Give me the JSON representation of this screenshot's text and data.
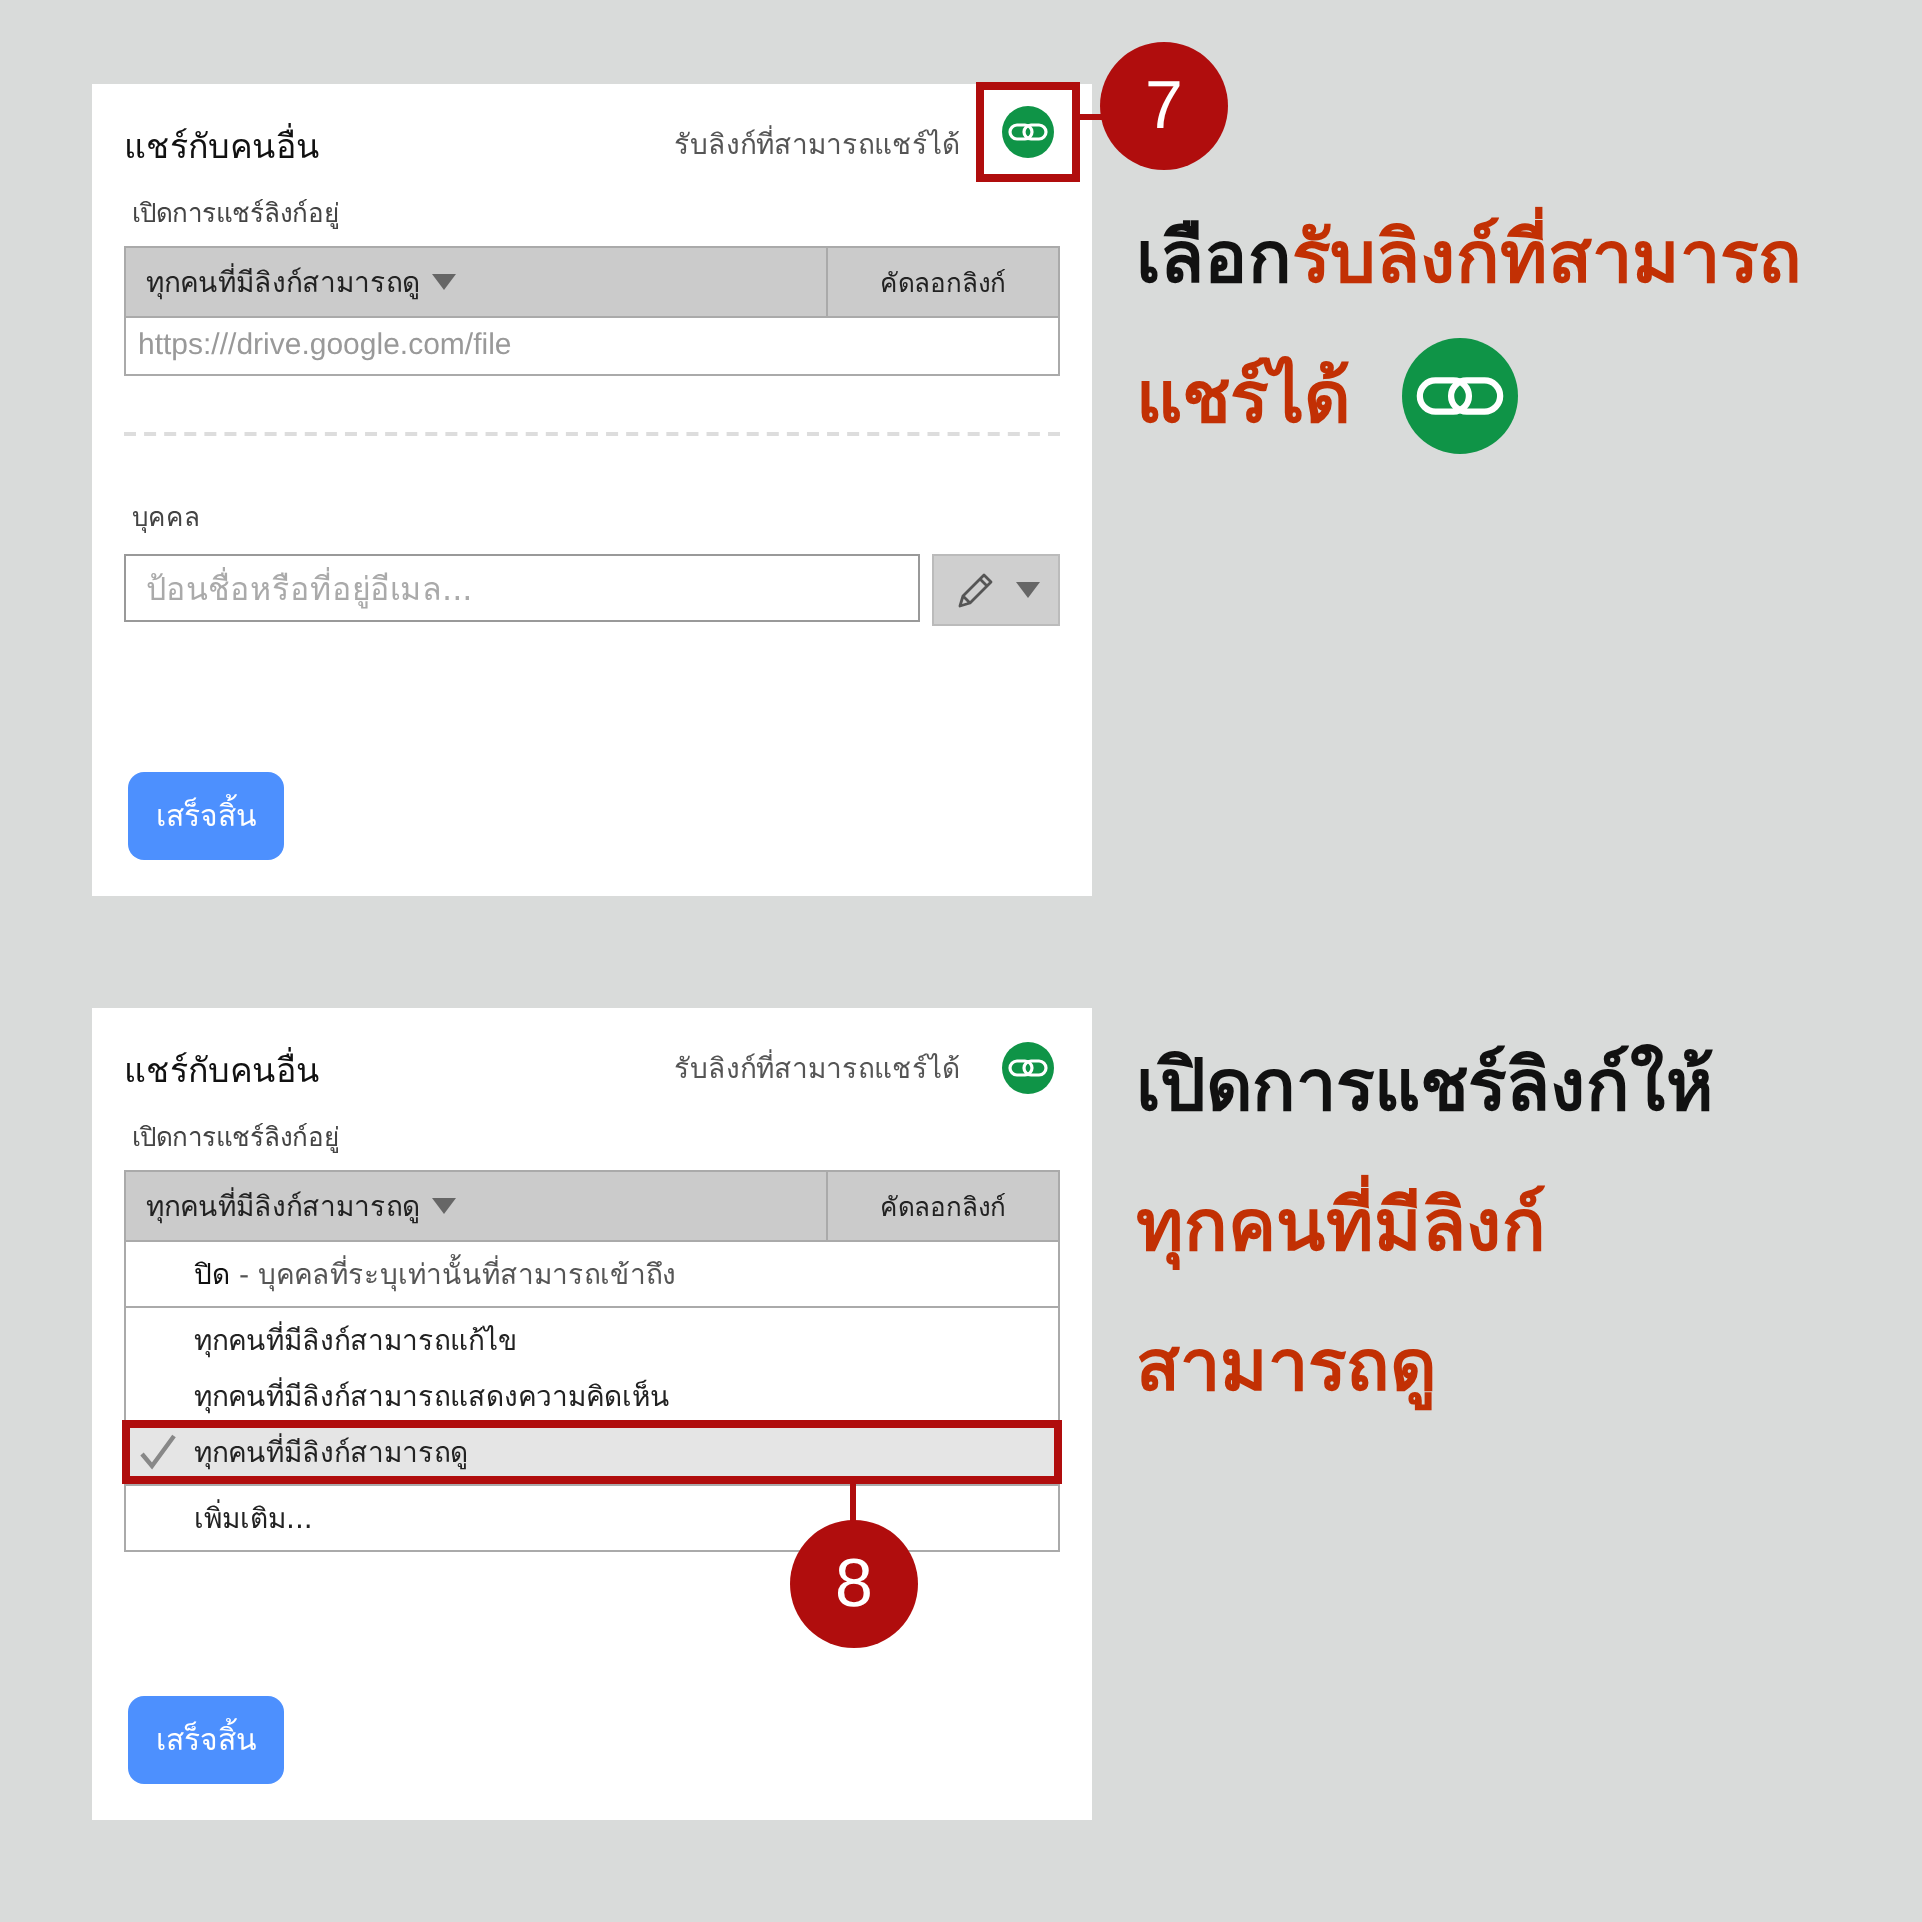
{
  "steps": [
    {
      "number": "7",
      "caption": [
        [
          {
            "text": "เลือก",
            "emphasis": false
          },
          {
            "text": "รับลิงก์ที่สามารถ",
            "emphasis": true
          }
        ],
        [
          {
            "text": "แชร์ได้",
            "emphasis": true
          }
        ]
      ],
      "caption_icon": true,
      "dialog": {
        "title": "แชร์กับคนอื่น",
        "link_label": "รับลิงก์ที่สามารถแชร์ได้",
        "link_icon_highlighted": true,
        "section_label": "เปิดการแชร์ลิงก์อยู่",
        "access": "ทุกคนที่มีลิงก์สามารถดู",
        "copy_link": "คัดลอกลิงก์",
        "url": "https:///drive.google.com/file",
        "people_label": "บุคคล",
        "people_placeholder": "ป้อนชื่อหรือที่อยู่อีเมล...",
        "done": "เสร็จสิ้น"
      }
    },
    {
      "number": "8",
      "caption": [
        [
          {
            "text": "เปิดการแชร์ลิงก์ให้",
            "emphasis": false
          }
        ],
        [
          {
            "text": "ทุกคนที่มีลิงก์",
            "emphasis": true
          }
        ],
        [
          {
            "text": "สามารถดู",
            "emphasis": true
          }
        ]
      ],
      "caption_icon": false,
      "dialog": {
        "title": "แชร์กับคนอื่น",
        "link_label": "รับลิงก์ที่สามารถแชร์ได้",
        "link_icon_highlighted": false,
        "section_label": "เปิดการแชร์ลิงก์อยู่",
        "access": "ทุกคนที่มีลิงก์สามารถดู",
        "copy_link": "คัดลอกลิงก์",
        "menu": [
          [
            {
              "label": "**ปิด** - บุคคลที่ระบุเท่านั้นที่สามารถเข้าถึง",
              "selected": false,
              "highlighted": false
            }
          ],
          [
            {
              "label": "ทุกคนที่มีลิงก์สามารถแก้ไข",
              "selected": false,
              "highlighted": false
            },
            {
              "label": "ทุกคนที่มีลิงก์สามารถแสดงความคิดเห็น",
              "selected": false,
              "highlighted": false
            },
            {
              "label": "ทุกคนที่มีลิงก์สามารถดู",
              "selected": true,
              "highlighted": true
            }
          ],
          [
            {
              "label": "เพิ่มเติม...",
              "selected": false,
              "highlighted": false
            }
          ]
        ],
        "done": "เสร็จสิ้น"
      }
    }
  ]
}
